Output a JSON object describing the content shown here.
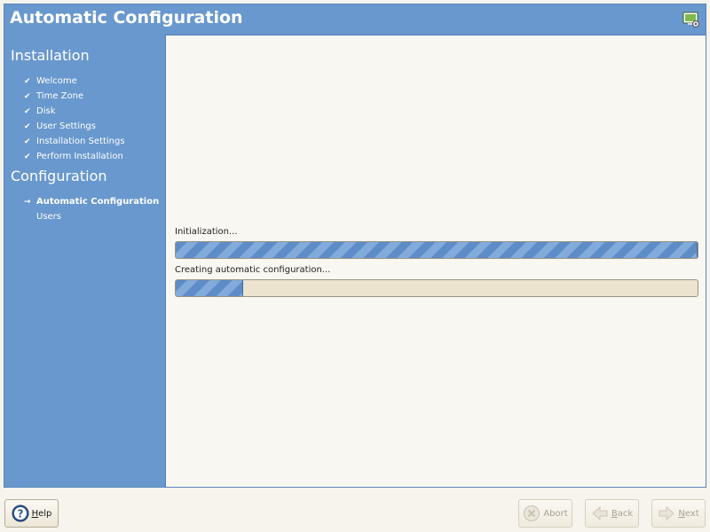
{
  "window": {
    "title": "Automatic Configuration"
  },
  "sidebar": {
    "sections": [
      {
        "heading": "Installation",
        "steps": [
          {
            "mark": "✔",
            "label": "Welcome"
          },
          {
            "mark": "✔",
            "label": "Time Zone"
          },
          {
            "mark": "✔",
            "label": "Disk"
          },
          {
            "mark": "✔",
            "label": "User Settings"
          },
          {
            "mark": "✔",
            "label": "Installation Settings"
          },
          {
            "mark": "✔",
            "label": "Perform Installation"
          }
        ]
      },
      {
        "heading": "Configuration",
        "steps": [
          {
            "mark": "→",
            "label": "Automatic Configuration",
            "current": true
          },
          {
            "mark": "",
            "label": "Users"
          }
        ]
      }
    ]
  },
  "main": {
    "progress": [
      {
        "label": "Initialization...",
        "value": 1.0
      },
      {
        "label": "Creating automatic configuration...",
        "value": 0.13
      }
    ]
  },
  "buttons": {
    "help": {
      "accel": "H",
      "rest": "elp",
      "enabled": true
    },
    "abort": {
      "accel": "",
      "text": "Abort",
      "enabled": false
    },
    "back": {
      "accel": "B",
      "rest": "ack",
      "enabled": false
    },
    "next": {
      "accel": "N",
      "rest": "ext",
      "enabled": false
    }
  },
  "colors": {
    "accent": "#6898cd",
    "content_bg": "#f9f7f1",
    "progress_fill": "#6f9cd3",
    "progress_track": "#ede4cf"
  }
}
